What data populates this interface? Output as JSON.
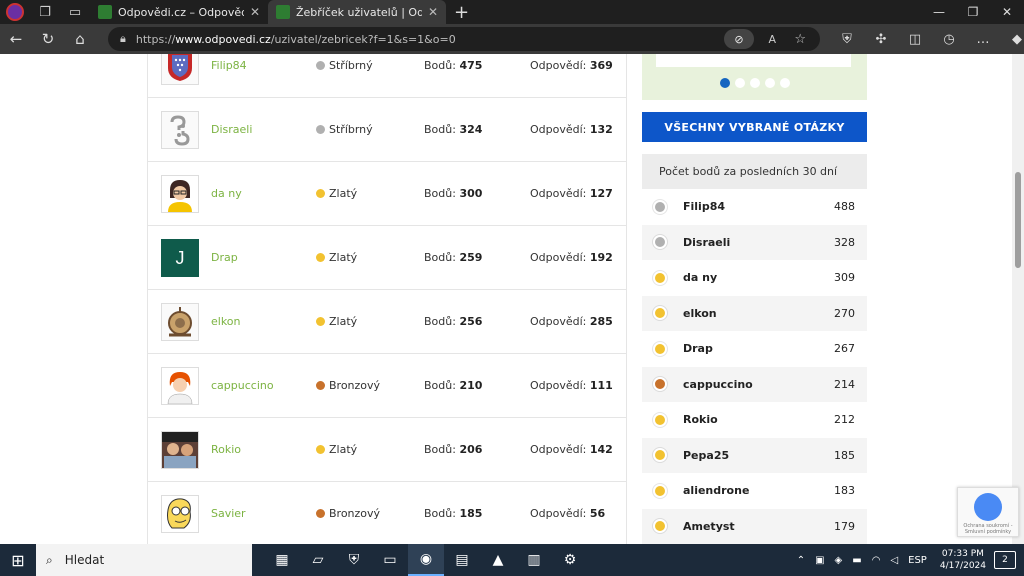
{
  "browser": {
    "tabs": [
      {
        "title": "Odpovědi.cz – Odpověď na každ",
        "active": false
      },
      {
        "title": "Žebříček uživatelů | Odpovědi.cz",
        "active": true
      }
    ],
    "url_prefix": "https://",
    "url_host": "www.odpovedi.cz",
    "url_path": "/uzivatel/zebricek?f=1&s=1&o=0"
  },
  "leaderboard": {
    "points_label": "Bodů:",
    "answers_label": "Odpovědí:",
    "rows": [
      {
        "name": "Filip84",
        "rank": "Stříbrný",
        "medal": "silver",
        "points": "475",
        "answers": "369"
      },
      {
        "name": "Disraeli",
        "rank": "Stříbrný",
        "medal": "silver",
        "points": "324",
        "answers": "132"
      },
      {
        "name": "da ny",
        "rank": "Zlatý",
        "medal": "gold",
        "points": "300",
        "answers": "127"
      },
      {
        "name": "Drap",
        "rank": "Zlatý",
        "medal": "gold",
        "points": "259",
        "answers": "192",
        "avatar_letter": "J"
      },
      {
        "name": "elkon",
        "rank": "Zlatý",
        "medal": "gold",
        "points": "256",
        "answers": "285"
      },
      {
        "name": "cappuccino",
        "rank": "Bronzový",
        "medal": "bronze",
        "points": "210",
        "answers": "111"
      },
      {
        "name": "Rokio",
        "rank": "Zlatý",
        "medal": "gold",
        "points": "206",
        "answers": "142"
      },
      {
        "name": "Savier",
        "rank": "Bronzový",
        "medal": "bronze",
        "points": "185",
        "answers": "56"
      }
    ]
  },
  "sidebar": {
    "all_questions_button": "VŠECHNY VYBRANÉ OTÁZKY",
    "points_title": "Počet bodů za posledních 30 dní",
    "points_rows": [
      {
        "name": "Filip84",
        "medal": "silver",
        "value": "488"
      },
      {
        "name": "Disraeli",
        "medal": "silver",
        "value": "328"
      },
      {
        "name": "da ny",
        "medal": "gold",
        "value": "309"
      },
      {
        "name": "elkon",
        "medal": "gold",
        "value": "270"
      },
      {
        "name": "Drap",
        "medal": "gold",
        "value": "267"
      },
      {
        "name": "cappuccino",
        "medal": "bronze",
        "value": "214"
      },
      {
        "name": "Rokio",
        "medal": "gold",
        "value": "212"
      },
      {
        "name": "Pepa25",
        "medal": "gold",
        "value": "185"
      },
      {
        "name": "aliendrone",
        "medal": "gold",
        "value": "183"
      },
      {
        "name": "Ametyst",
        "medal": "gold",
        "value": "179"
      }
    ]
  },
  "recaptcha_text": "Ochrana soukromí - Smluvní podmínky",
  "taskbar": {
    "search_label": "Hledat",
    "lang": "ESP",
    "time": "07:33 PM",
    "date": "4/17/2024",
    "notifications": "2"
  },
  "colors": {
    "accent_blue": "#0d56c9",
    "username_green": "#7cb342",
    "silver": "#b0b0b0",
    "gold": "#f2c230",
    "bronze": "#c8722c"
  }
}
